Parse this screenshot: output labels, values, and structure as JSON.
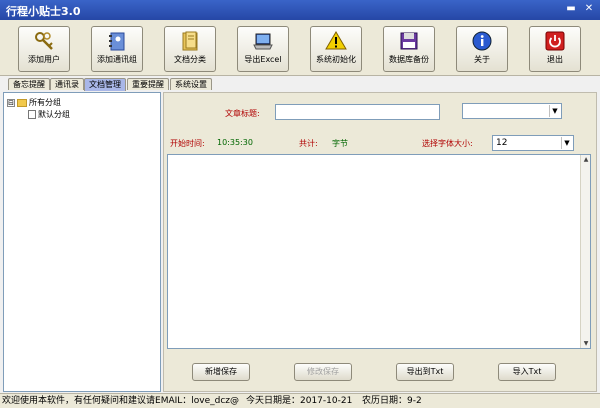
{
  "window": {
    "title": "行程小贴士3.0"
  },
  "toolbar": {
    "buttons": [
      {
        "label": "添加用户",
        "icon": "keys-icon"
      },
      {
        "label": "添加通讯组",
        "icon": "contact-book-icon"
      },
      {
        "label": "文档分类",
        "icon": "folder-icon"
      },
      {
        "label": "导出Excel",
        "icon": "laptop-icon"
      },
      {
        "label": "系统初始化",
        "icon": "warning-icon"
      },
      {
        "label": "数据库备份",
        "icon": "floppy-disk-icon"
      },
      {
        "label": "关于",
        "icon": "info-icon"
      },
      {
        "label": "退出",
        "icon": "power-icon"
      }
    ]
  },
  "tabs": [
    {
      "label": "备忘提醒"
    },
    {
      "label": "通讯录"
    },
    {
      "label": "文档管理"
    },
    {
      "label": "重要提醒"
    },
    {
      "label": "系统设置"
    }
  ],
  "active_tab": "文档管理",
  "tree": {
    "root": {
      "label": "所有分组",
      "toggle": "⊟"
    },
    "child": {
      "label": "默认分组"
    }
  },
  "form": {
    "title_label": "文章标题:",
    "title_value": "",
    "category_value": "",
    "start_time_label": "开始时间:",
    "start_time_value": "10:35:30",
    "total_label": "共计:",
    "total_unit": "字节",
    "font_size_label": "选择字体大小:",
    "font_size_value": "12"
  },
  "actions": {
    "new_save": "新增保存",
    "modify_save": "修改保存",
    "export_txt": "导出到Txt",
    "import_txt": "导入Txt"
  },
  "status": {
    "message": "欢迎使用本软件，有任何疑问和建议请EMAIL：love_dcz@",
    "today": "今天日期是：2017-10-21",
    "lunar": "农历日期：9-2"
  },
  "colors": {
    "titlebar": "#2647a6",
    "active_tab": "#a9b7e8",
    "label_red": "#b00000",
    "label_green": "#006600"
  }
}
